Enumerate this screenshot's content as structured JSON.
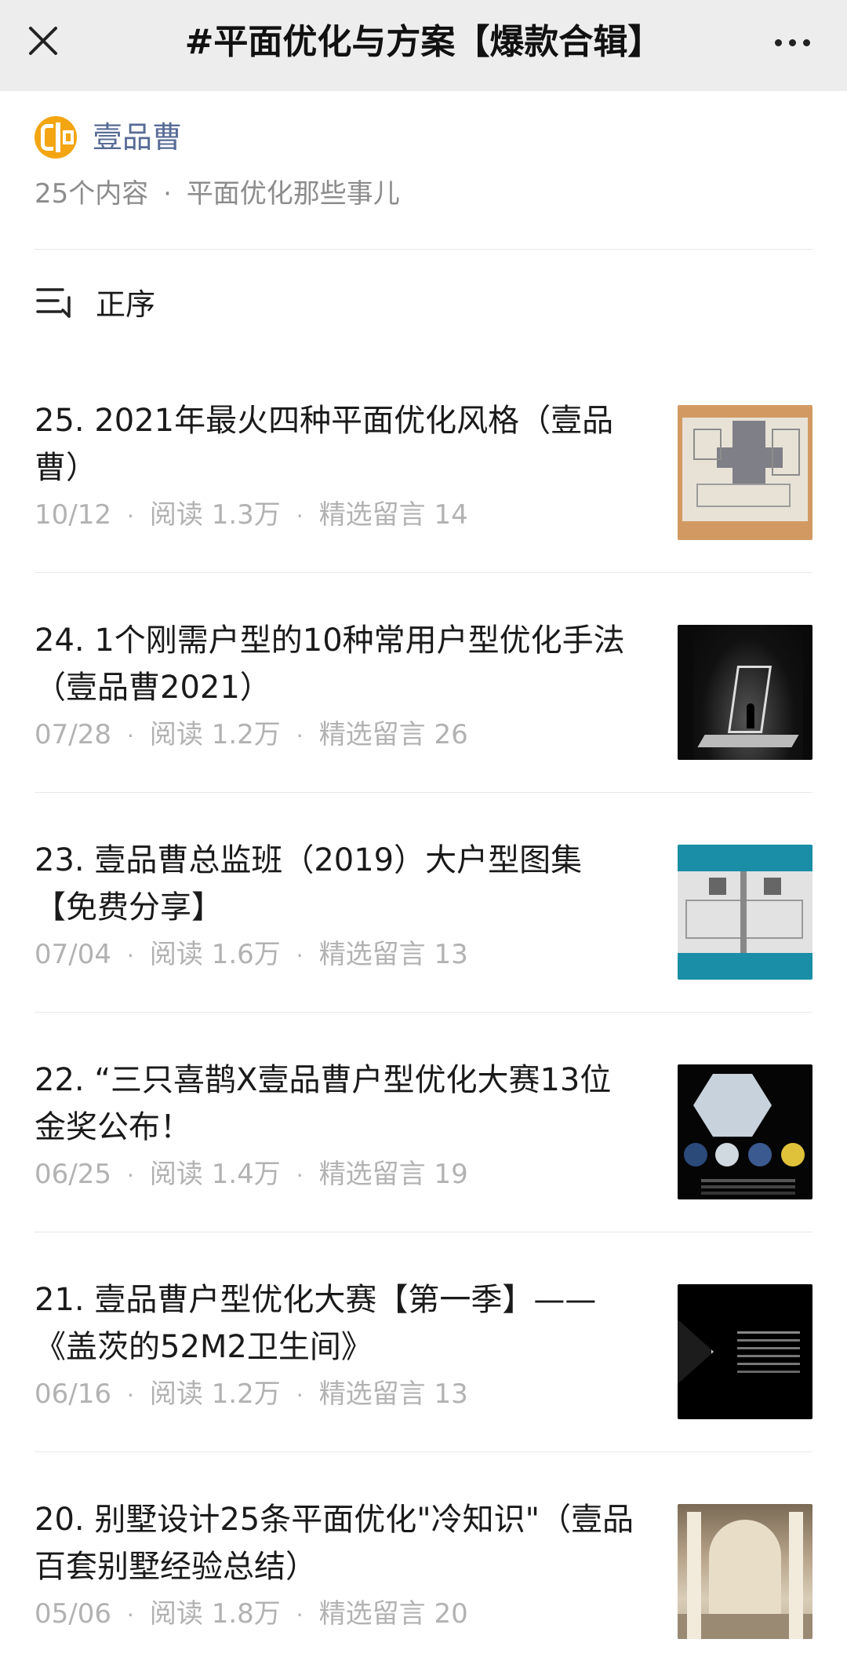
{
  "nav": {
    "title": "#平面优化与方案【爆款合辑】",
    "close_icon": "close-icon",
    "more_icon": "more-icon"
  },
  "header": {
    "account_name": "壹品曹",
    "content_count": "25个内容",
    "separator": "·",
    "topic": "平面优化那些事儿"
  },
  "sort": {
    "label": "正序",
    "icon": "sort-icon"
  },
  "articles": [
    {
      "title": "25. 2021年最火四种平面优化风格（壹品曹）",
      "date": "10/12",
      "reads": "阅读 1.3万",
      "comments": "精选留言 14"
    },
    {
      "title": "24. 1个刚需户型的10种常用户型优化手法（壹品曹2021）",
      "date": "07/28",
      "reads": "阅读 1.2万",
      "comments": "精选留言 26"
    },
    {
      "title": "23. 壹品曹总监班（2019）大户型图集【免费分享】",
      "date": "07/04",
      "reads": "阅读 1.6万",
      "comments": "精选留言 13"
    },
    {
      "title": "22. “三只喜鹊X壹品曹户型优化大赛13位金奖公布！",
      "date": "06/25",
      "reads": "阅读 1.4万",
      "comments": "精选留言 19"
    },
    {
      "title": "21. 壹品曹户型优化大赛【第一季】——《盖茨的52M2卫生间》",
      "date": "06/16",
      "reads": "阅读 1.2万",
      "comments": "精选留言 13"
    },
    {
      "title": "20. 别墅设计25条平面优化\"冷知识\"（壹品百套别墅经验总结）",
      "date": "05/06",
      "reads": "阅读 1.8万",
      "comments": "精选留言 20"
    }
  ],
  "meta_separator": "·",
  "colors": {
    "topbar_bg": "#ededed",
    "account_link": "#576b95",
    "meta_text": "#b2b2b2",
    "avatar": "#f3a512"
  }
}
